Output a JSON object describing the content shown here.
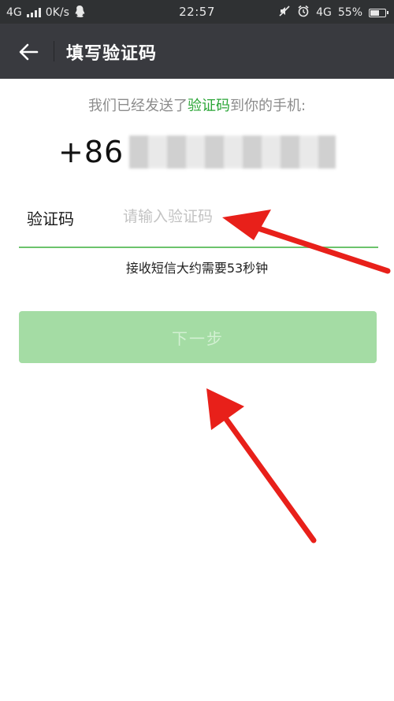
{
  "status_bar": {
    "network_left": "4G",
    "speed": "0K/s",
    "time": "22:57",
    "network_right": "4G",
    "battery": "55%",
    "icons": [
      "signal-icon",
      "qq-icon",
      "mute-icon",
      "alarm-icon",
      "battery-icon"
    ]
  },
  "header": {
    "title": "填写验证码",
    "back_icon": "back-arrow-icon"
  },
  "verify": {
    "sent_prefix": "我们已经发送了",
    "sent_highlight": "验证码",
    "sent_suffix": "到你的手机:",
    "phone_prefix": "+86",
    "code_label": "验证码",
    "code_placeholder": "请输入验证码",
    "code_value": "",
    "sms_hint": "接收短信大约需要53秒钟",
    "next_button": "下一步"
  },
  "colors": {
    "status_bg": "#2f3133",
    "title_bg": "#393a3f",
    "accent_green": "#2aa536",
    "underline_green": "#6cc36c",
    "button_disabled_green": "#a4dca4",
    "annotation_red": "#e8201a"
  }
}
